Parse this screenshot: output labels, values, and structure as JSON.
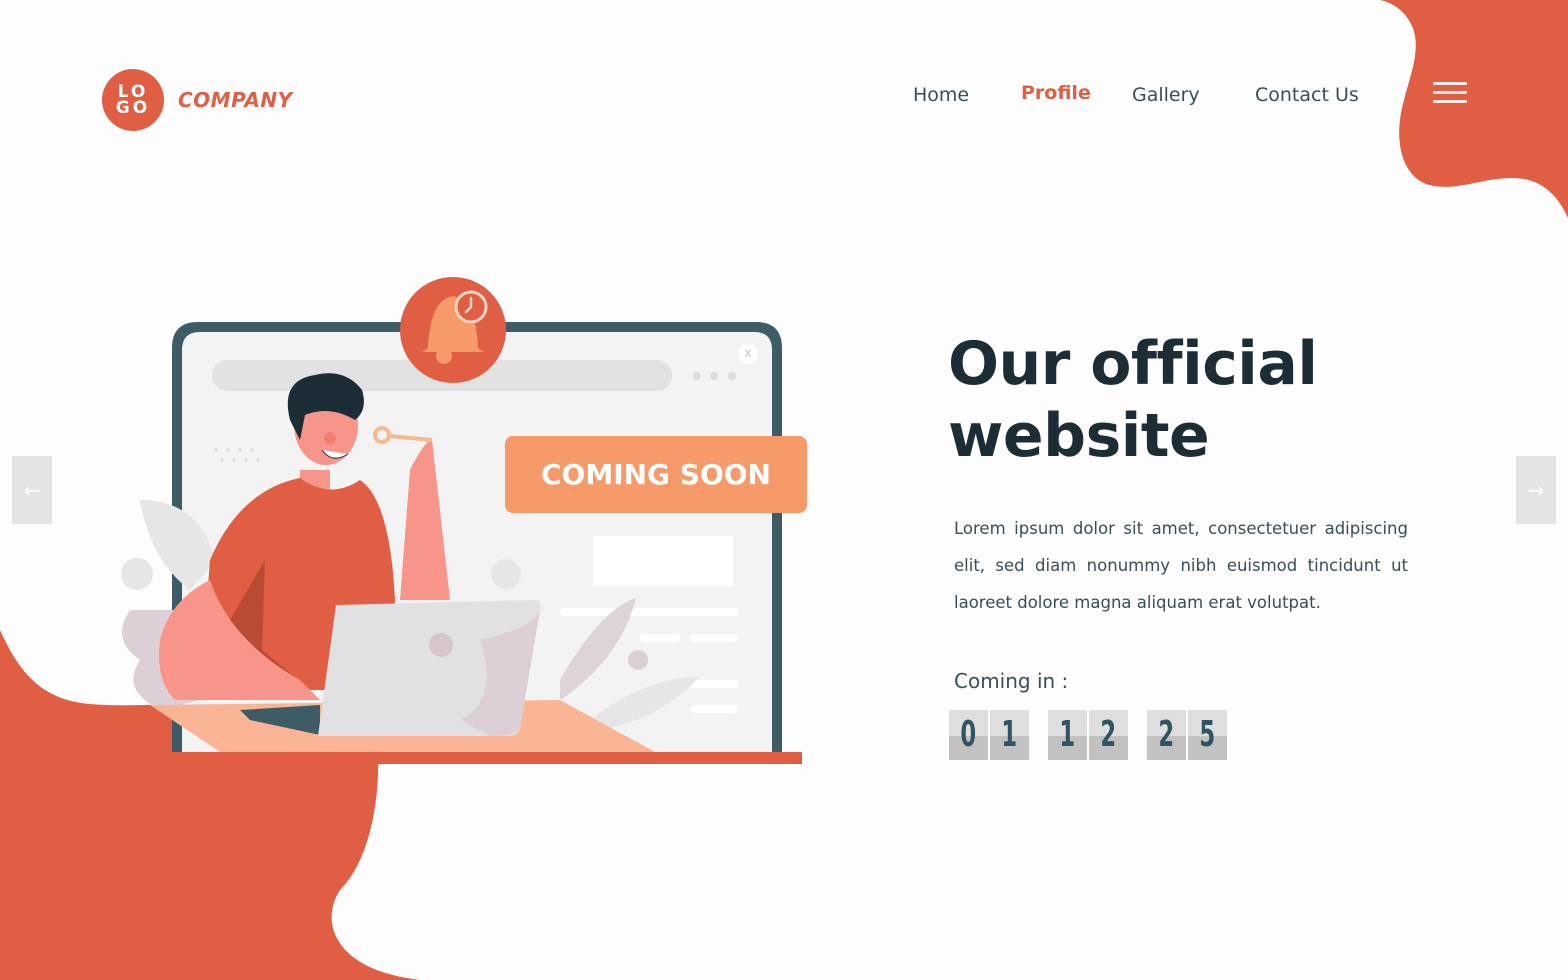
{
  "brand": {
    "logo_line1": "LO",
    "logo_line2": "GO",
    "company_name": "COMPANY"
  },
  "nav": {
    "items": [
      {
        "label": "Home",
        "active": false
      },
      {
        "label": "Profile",
        "active": true
      },
      {
        "label": "Gallery",
        "active": false
      },
      {
        "label": "Contact Us",
        "active": false
      }
    ],
    "menu_icon": "hamburger-icon"
  },
  "carousel": {
    "prev_icon": "←",
    "next_icon": "→"
  },
  "illustration": {
    "banner_text": "COMING SOON",
    "close_label": "x",
    "icons": [
      "bell-icon",
      "clock-icon",
      "key-icon",
      "laptop-icon"
    ]
  },
  "hero": {
    "headline_line1": "Our official",
    "headline_line2": "website",
    "description": "Lorem ipsum dolor sit amet, consectetuer adipiscing elit, sed diam nonummy nibh euismod tincidunt ut laoreet dolore magna aliquam erat volutpat.",
    "countdown_label": "Coming in :",
    "countdown": {
      "group1": [
        "0",
        "1"
      ],
      "group2": [
        "1",
        "2"
      ],
      "group3": [
        "2",
        "5"
      ]
    }
  },
  "colors": {
    "accent": "#e05f44",
    "banner": "#f79a6a",
    "dark_text": "#1d2d36",
    "body_text": "#3b4d57",
    "frame": "#3d5c66"
  }
}
